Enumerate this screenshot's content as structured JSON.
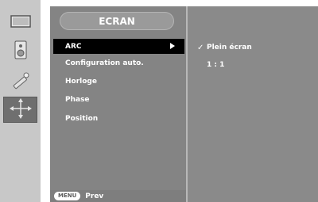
{
  "sidebar": {
    "items": [
      {
        "icon": "screen-picture-icon"
      },
      {
        "icon": "speaker-icon"
      },
      {
        "icon": "tool-icon"
      },
      {
        "icon": "position-adjust-icon"
      }
    ]
  },
  "header": {
    "title": "ECRAN"
  },
  "menu": {
    "items": [
      {
        "label": "ARC"
      },
      {
        "label": "Configuration auto."
      },
      {
        "label": "Horloge"
      },
      {
        "label": "Phase"
      },
      {
        "label": "Position"
      }
    ]
  },
  "submenu": {
    "options": [
      {
        "label": "Plein écran",
        "checked": true
      },
      {
        "label": "1 : 1",
        "checked": false
      }
    ],
    "check_glyph": "✓"
  },
  "footer": {
    "key_label": "MENU",
    "prev_label": "Prev"
  },
  "colors": {
    "selected_bg": "#000000",
    "panel_bg": "#858585",
    "sidebar_bg": "#c8c8c8"
  }
}
